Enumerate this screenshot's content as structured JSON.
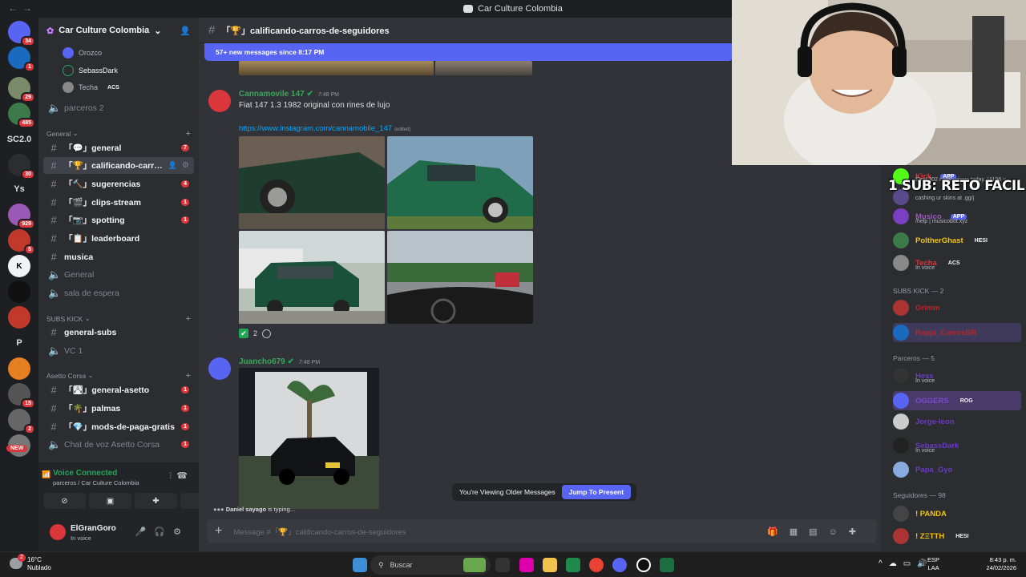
{
  "window": {
    "title": "Car Culture Colombia"
  },
  "server_rail": {
    "badges": [
      "34",
      "1",
      "29",
      "485",
      "30",
      "929",
      "5",
      "15",
      "2"
    ],
    "labels": [
      "SC2.0",
      "Ys",
      "P"
    ],
    "new_label": "NEW"
  },
  "guild": {
    "name": "Car Culture Colombia"
  },
  "voice_users": [
    {
      "name": "Orozco"
    },
    {
      "name": "SebassDark"
    },
    {
      "name": "Techa",
      "tag": "ACS"
    }
  ],
  "channels_top": [
    {
      "name": "parceros 2"
    }
  ],
  "categories": {
    "general": "General",
    "subs": "SUBS KICK",
    "asetto": "Asetto Corsa"
  },
  "channels_general": [
    {
      "name": "「💬」general",
      "count": "7"
    },
    {
      "name": "「🏆」calificando-carros...",
      "count": ""
    },
    {
      "name": "「🔨」sugerencias",
      "count": "4"
    },
    {
      "name": "「🎬」clips-stream",
      "count": "1"
    },
    {
      "name": "「📷」spotting",
      "count": "1"
    },
    {
      "name": "「📋」leaderboard",
      "count": ""
    },
    {
      "name": "musica",
      "count": ""
    },
    {
      "name": "General",
      "count": ""
    },
    {
      "name": "sala de espera",
      "count": ""
    }
  ],
  "channels_subs": [
    {
      "name": "general-subs"
    },
    {
      "name": "VC 1"
    }
  ],
  "channels_asetto": [
    {
      "name": "「🛣」general-asetto",
      "count": "1"
    },
    {
      "name": "「🌴」palmas",
      "count": "1"
    },
    {
      "name": "「💎」mods-de-paga-gratis",
      "count": "1"
    },
    {
      "name": "Chat de voz Asetto Corsa",
      "count": "1"
    }
  ],
  "voice_status": {
    "title": "Voice Connected",
    "sub": "parceros / Car Culture Colombia"
  },
  "user": {
    "name": "ElGranGoro",
    "status": "In voice"
  },
  "chat": {
    "channel": "「🏆」calificando-carros-de-seguidores",
    "new_messages": "57+ new messages since 8:17 PM",
    "messages": [
      {
        "author": "Cannamovile 147",
        "time": "7:48 PM",
        "text": "Fiat 147 1.3 1982 original con rines de lujo",
        "link": "https://www.instagram.com/cannamobile_147",
        "edited": "(edited)",
        "reaction_count": "2"
      },
      {
        "author": "Juancho679",
        "time": "7:48 PM"
      }
    ],
    "typing": {
      "user": "Daniel sayago",
      "text": " is typing..."
    },
    "older_notice": "You're Viewing Older Messages",
    "jump_label": "Jump To Present",
    "composer_placeholder": "Message #「🏆」calificando-carros-de-seguidores"
  },
  "stream_overlay": {
    "text": "1 SUB: RETO FACIL"
  },
  "members": {
    "top": [
      {
        "name": "Kick",
        "tag": "APP",
        "sub": "Sent 302 notifications today. (4196 y..."
      },
      {
        "name": "",
        "tag": "",
        "sub": "cashing ur skins at .gg/j"
      },
      {
        "name": "Musico",
        "tag": "APP",
        "sub": "/help | musicobot.xyz"
      },
      {
        "name": "PoltherGhast",
        "tag": "HESI",
        "sub": ""
      },
      {
        "name": "Techa",
        "tag": "ACS",
        "sub": "In voice"
      }
    ],
    "subs_header": "SUBS KICK — 2",
    "subs": [
      {
        "name": "Grimm"
      },
      {
        "name": "Rappi_CarrosBR"
      }
    ],
    "parceros_header": "Parceros — 5",
    "parceros": [
      {
        "name": "Hess",
        "tag": "",
        "sub": "In voice"
      },
      {
        "name": "OGGERS",
        "tag": "ROG",
        "sub": ""
      },
      {
        "name": "Jorge-leon",
        "tag": "",
        "sub": ""
      },
      {
        "name": "SebassDark",
        "tag": "",
        "sub": "In voice"
      },
      {
        "name": "Papa_Gyo",
        "tag": "",
        "sub": ""
      }
    ],
    "seguidores_header": "Seguidores — 98",
    "seguidores": [
      {
        "name": "! PANDA",
        "tag": ""
      },
      {
        "name": "! ZΞTTH",
        "tag": "HESI"
      }
    ]
  },
  "taskbar": {
    "weather_temp": "16°C",
    "weather_desc": "Nublado",
    "weather_badge": "2",
    "search_placeholder": "Buscar",
    "lang_top": "ESP",
    "lang_bottom": "LAA",
    "time": "8:43 p. m.",
    "date": "24/02/2026"
  },
  "colors": {
    "accent": "#5865f2",
    "online": "#23a55a",
    "unread_badge": "#da373c",
    "link": "#00a8fc"
  }
}
